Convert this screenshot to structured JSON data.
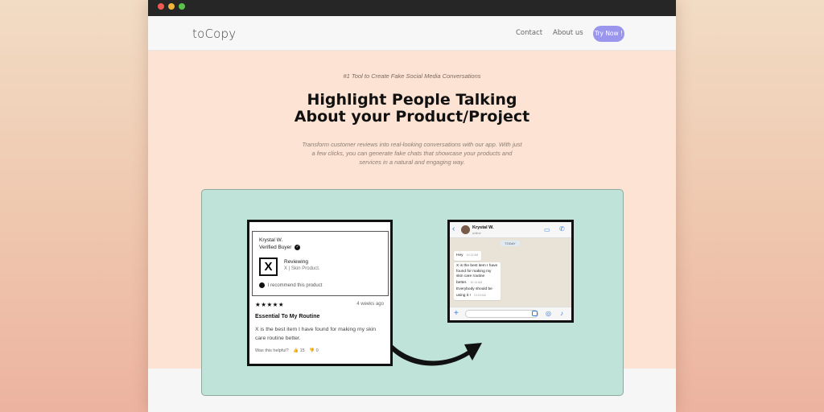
{
  "navbar": {
    "logo": "toCopy",
    "links": [
      "Contact",
      "About us"
    ],
    "cta": "Try Now !"
  },
  "hero": {
    "tagline": "#1 Tool to Create Fake Social Media Conversations",
    "headline_line1": "Highlight People Talking",
    "headline_line2": "About your Product/Project",
    "subtext": "Transform customer reviews into real-looking conversations with our app. With just a few clicks, you can generate fake chats that showcase your products and services in a natural and engaging way."
  },
  "review": {
    "reviewer": "Krystal W.",
    "verified": "Verified Buyer",
    "reviewing_label": "Reviewing",
    "product": "X | Skin Product.",
    "logo_letter": "X",
    "recommend": "I recommend this product",
    "stars": "★★★★★",
    "rating": 5,
    "date": "4 weeks ago",
    "title": "Essential To My Routine",
    "body": "X is the best item I have found for making my skin care routine better.",
    "helpful_label": "Was this helpful?",
    "helpful_yes": "15",
    "helpful_no": "0"
  },
  "chat": {
    "contact_name": "Krystal W.",
    "contact_status": "online",
    "date_badge": "TODAY",
    "messages": [
      {
        "text": "Hey",
        "time": "10:13 AM"
      },
      {
        "text": "X is the best item I have found for making my skin care routine better.",
        "time": "10:14 AM"
      },
      {
        "text": "Everybody should be using it !",
        "time": "10:15 AM"
      }
    ]
  },
  "icons": {
    "check": "check-icon",
    "thumb": "thumbs-up-icon",
    "back": "chevron-left-icon",
    "video": "video-icon",
    "phone": "phone-icon",
    "plus": "plus-icon",
    "camera": "camera-icon",
    "mic": "mic-icon"
  },
  "colors": {
    "hero_bg": "#fde3d3",
    "showcase_bg": "#bfe3d9",
    "cta_bg": "#9a96ee",
    "chat_accent": "#3a7bd5"
  }
}
